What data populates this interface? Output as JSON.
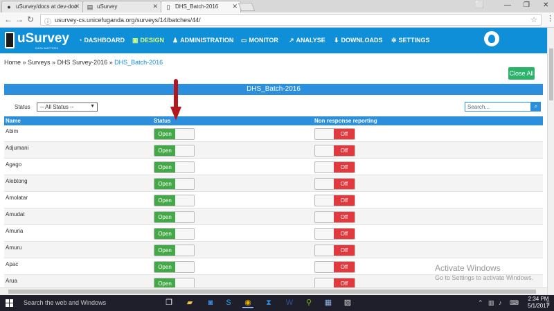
{
  "browser": {
    "tabs": [
      {
        "label": "uSurvey/docs at dev-doc",
        "icon": "github-icon"
      },
      {
        "label": "uSurvey",
        "icon": "document-icon"
      },
      {
        "label": "DHS_Batch-2016",
        "icon": "mobile-icon"
      }
    ],
    "url": "usurvey-cs.unicefuganda.org/surveys/14/batches/44/"
  },
  "app": {
    "brand": "uSurvey",
    "tagline": "DATA MATTERS",
    "nav": [
      {
        "label": "DASHBOARD",
        "icon": "dashboard-icon",
        "active": false
      },
      {
        "label": "DESIGN",
        "icon": "design-icon",
        "active": true
      },
      {
        "label": "ADMINISTRATION",
        "icon": "users-icon",
        "active": false
      },
      {
        "label": "MONITOR",
        "icon": "monitor-icon",
        "active": false
      },
      {
        "label": "ANALYSE",
        "icon": "chart-icon",
        "active": false
      },
      {
        "label": "DOWNLOADS",
        "icon": "download-icon",
        "active": false
      },
      {
        "label": "SETTINGS",
        "icon": "gear-icon",
        "active": false
      }
    ],
    "accent": "#0f8fd8"
  },
  "breadcrumb": {
    "items": [
      "Home",
      "Surveys",
      "DHS Survey-2016"
    ],
    "current": "DHS_Batch-2016"
  },
  "close_all_label": "Close All",
  "panel": {
    "title": "DHS_Batch-2016",
    "status_filter_label": "Status",
    "status_filter_value": "-- All Status --",
    "search_placeholder": "Search..."
  },
  "table": {
    "columns": [
      "Name",
      "Status",
      "Non response reporting"
    ],
    "rows": [
      {
        "name": "Abim",
        "status": "Open",
        "nr": "Off"
      },
      {
        "name": "Adjumani",
        "status": "Open",
        "nr": "Off"
      },
      {
        "name": "Agago",
        "status": "Open",
        "nr": "Off"
      },
      {
        "name": "Alebtong",
        "status": "Open",
        "nr": "Off"
      },
      {
        "name": "Amolatar",
        "status": "Open",
        "nr": "Off"
      },
      {
        "name": "Amudat",
        "status": "Open",
        "nr": "Off"
      },
      {
        "name": "Amuria",
        "status": "Open",
        "nr": "Off"
      },
      {
        "name": "Amuru",
        "status": "Open",
        "nr": "Off"
      },
      {
        "name": "Apac",
        "status": "Open",
        "nr": "Off"
      },
      {
        "name": "Arua",
        "status": "Open",
        "nr": "Off"
      }
    ]
  },
  "watermark": {
    "line1": "Activate Windows",
    "line2": "Go to Settings to activate Windows."
  },
  "taskbar": {
    "search_text": "Search the web and Windows",
    "time": "2:34 PM",
    "date": "5/1/2017"
  }
}
